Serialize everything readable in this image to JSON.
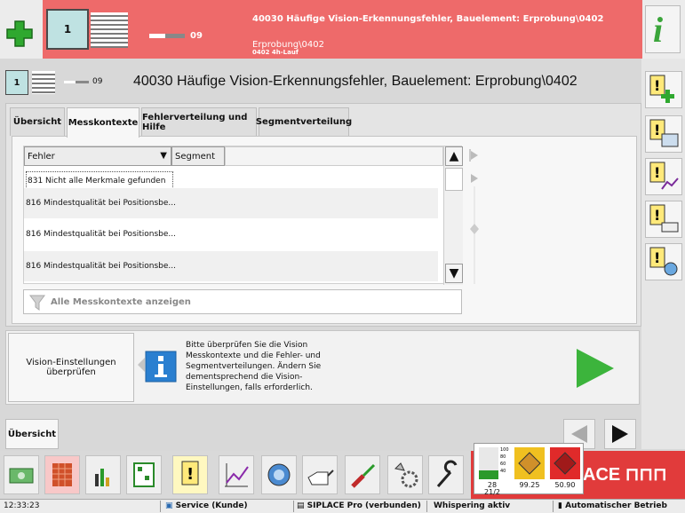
{
  "header": {
    "counter": "1",
    "progress_value": "09",
    "progress_fraction": 0.45,
    "alarm_title": "40030 Häufige Vision-Erkennungsfehler, Bauelement: Erprobung\\0402",
    "alarm_line2": "Erprobung\\0402",
    "alarm_line3": "0402 4h-Lauf",
    "alarm_color": "#ee6a6a"
  },
  "page": {
    "counter": "1",
    "progress_value": "09",
    "title": "40030 Häufige Vision-Erkennungsfehler, Bauelement: Erprobung\\0402"
  },
  "tabs": [
    {
      "label": "Übersicht"
    },
    {
      "label": "Messkontexte"
    },
    {
      "label": "Fehlerverteilung und Hilfe"
    },
    {
      "label": "Segmentverteilung"
    }
  ],
  "table": {
    "columns": [
      "Fehler",
      "Segment"
    ],
    "rows": [
      {
        "fehler": "831 Nicht alle Merkmale gefunden",
        "segment": ""
      },
      {
        "fehler": "816 Mindestqualität bei Positionsbe...",
        "segment": ""
      },
      {
        "fehler": "816 Mindestqualität bei Positionsbe...",
        "segment": ""
      },
      {
        "fehler": "816 Mindestqualität bei Positionsbe...",
        "segment": ""
      }
    ]
  },
  "filter": {
    "label": "Alle Messkontexte anzeigen"
  },
  "advice": {
    "button_label": "Vision-Einstellungen überprüfen",
    "text": "Bitte überprüfen Sie die Vision Messkontexte und die Fehler- und Segmentverteilungen. Ändern Sie dementsprechend die Vision-Einstellungen, falls erforderlich."
  },
  "nav": {
    "overview_label": "Übersicht"
  },
  "gauges": [
    {
      "value": "28",
      "sub": "21/2",
      "ticks": [
        "100",
        "80",
        "60",
        "40",
        "20"
      ]
    },
    {
      "value": "99.25",
      "sub": "",
      "ticks": [
        "100",
        "80",
        "60",
        "40",
        "20"
      ]
    },
    {
      "value": "50.90",
      "sub": "",
      "ticks": [
        "100",
        "80",
        "60",
        "40",
        "20"
      ]
    }
  ],
  "brand": {
    "logo_text": "ACE  ⊓⊓⊓",
    "color": "#e13b3b"
  },
  "status_bar": {
    "time": "12:33:23",
    "service": "Service (Kunde)",
    "connection": "SIPLACE Pro (verbunden)",
    "whispering": "Whispering aktiv",
    "mode": "Automatischer Betrieb"
  },
  "colors": {
    "accent_green": "#3cb43c",
    "counter_bg": "#bfe2e2",
    "info_blue": "#2a7fd0"
  }
}
